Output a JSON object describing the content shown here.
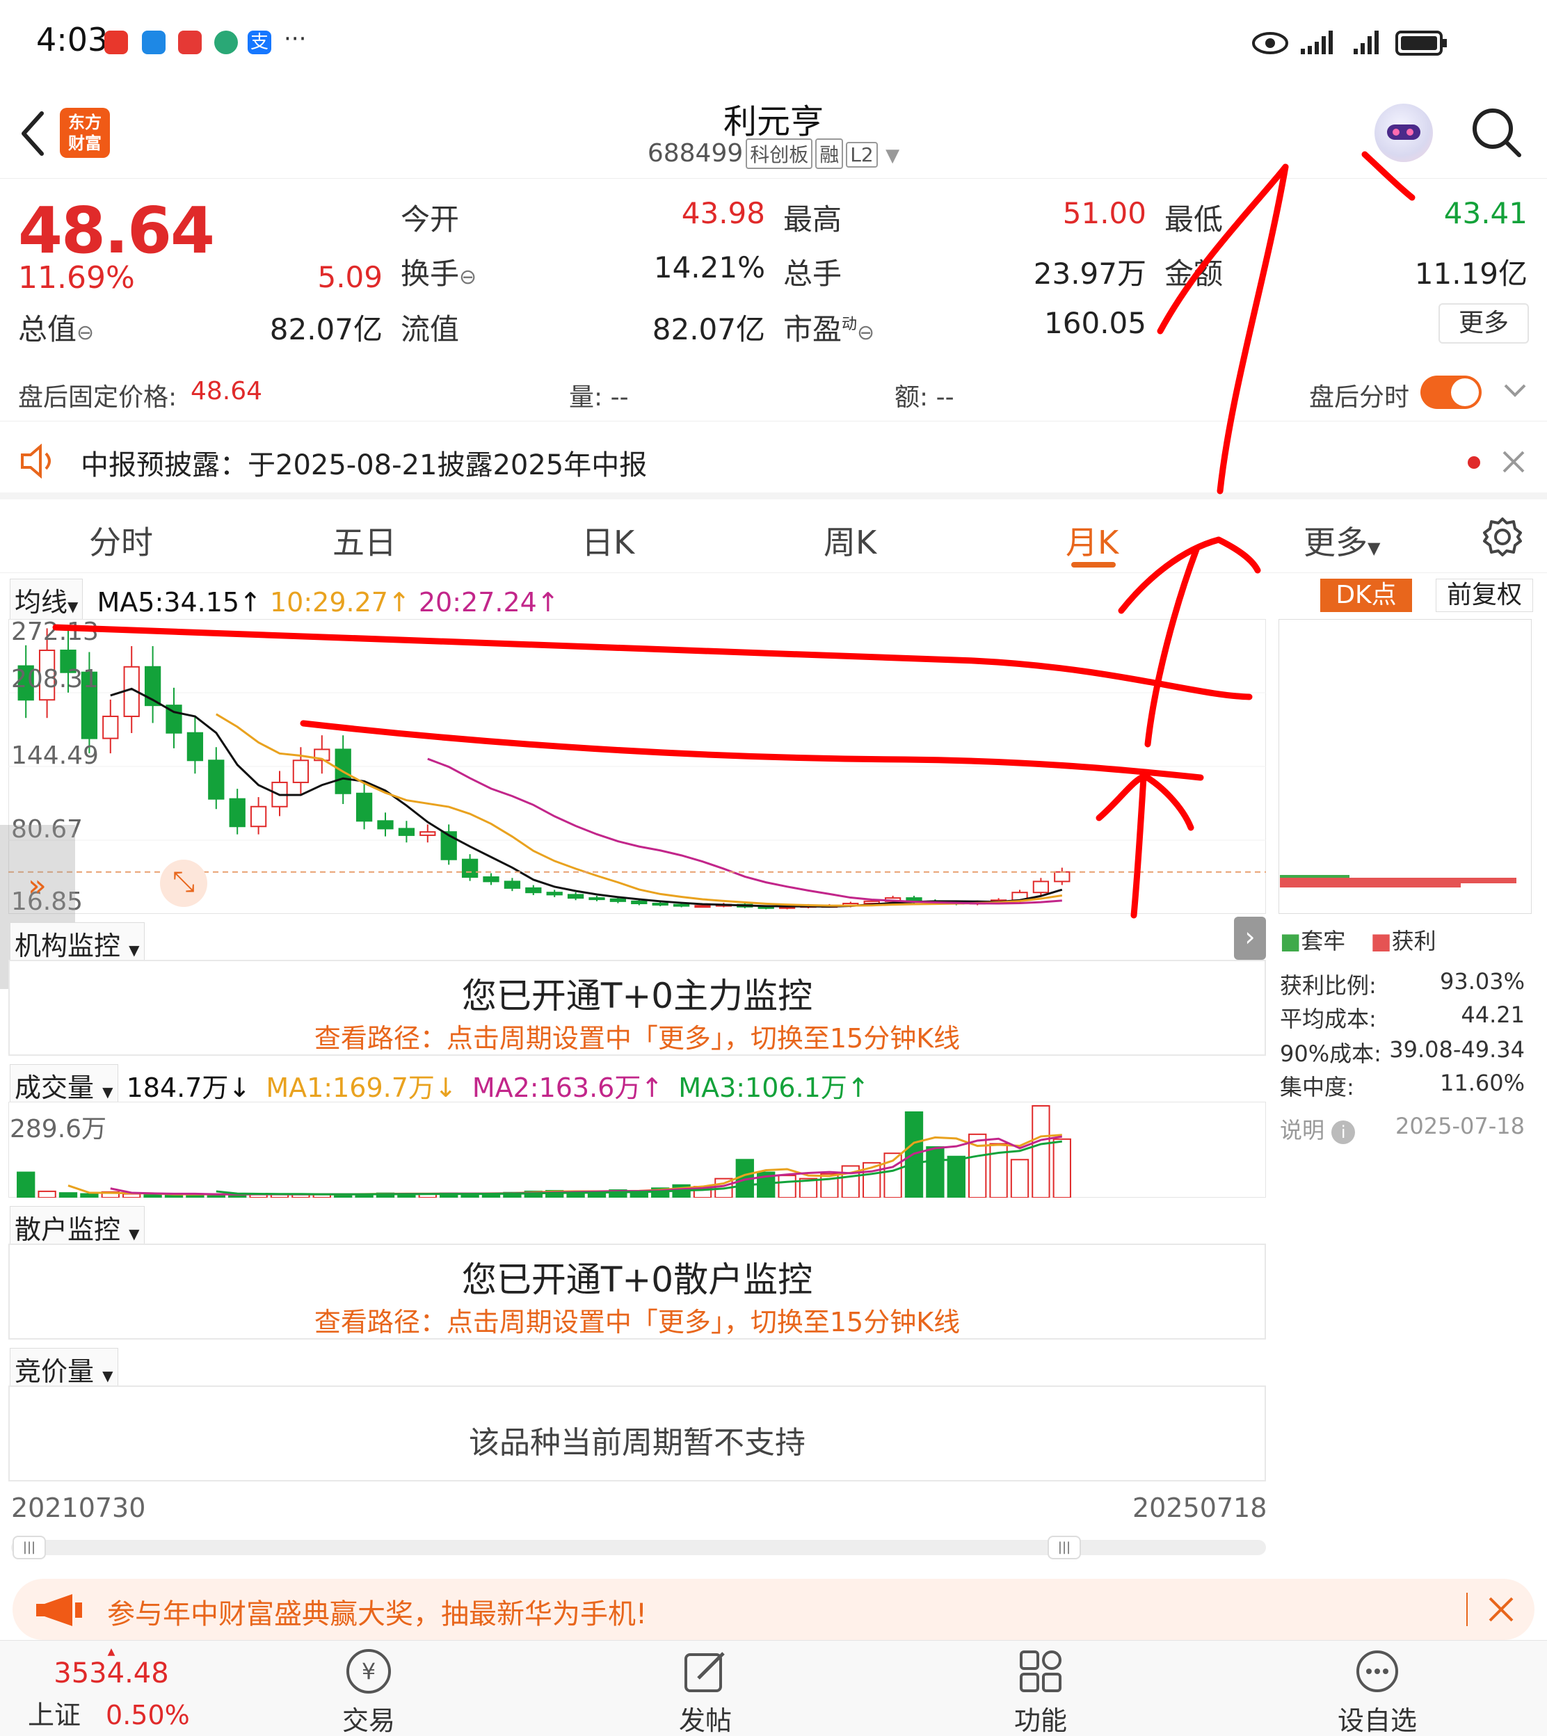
{
  "status_bar": {
    "time": "4:03",
    "more": "···"
  },
  "header": {
    "back_icon": "chevron-left-icon",
    "logo_text": [
      "东方",
      "财富"
    ],
    "stock_name": "利元亨",
    "stock_code": "688499",
    "tags": [
      "科创板",
      "融",
      "L2"
    ],
    "search_icon": "search-icon"
  },
  "quote": {
    "price": "48.64",
    "change_pct": "11.69%",
    "change_amt": "5.09",
    "total_value_label": "总值",
    "total_value": "82.07亿",
    "open_label": "今开",
    "open": "43.98",
    "turnover_label": "换手",
    "turnover": "14.21%",
    "float_value_label": "流值",
    "float_value": "82.07亿",
    "high_label": "最高",
    "high": "51.00",
    "volume_label": "总手",
    "volume": "23.97万",
    "pe_label": "市盈",
    "pe_sup": "动",
    "pe": "160.05",
    "low_label": "最低",
    "low": "43.41",
    "amount_label": "金额",
    "amount": "11.19亿",
    "more_button": "更多"
  },
  "after_hours": {
    "fixed_price_label": "盘后固定价格:",
    "fixed_price": "48.64",
    "vol_label": "量: --",
    "amt_label": "额: --",
    "toggle_label": "盘后分时"
  },
  "notice": {
    "text": "中报预披露：于2025-08-21披露2025年中报"
  },
  "tabs": [
    "分时",
    "五日",
    "日K",
    "周K",
    "月K",
    "更多"
  ],
  "active_tab": "月K",
  "kline": {
    "indicator_dropdown": "均线",
    "ma5": "MA5:34.15↑",
    "ma10": "10:29.27↑",
    "ma20": "20:27.24↑",
    "dk_button": "DK点",
    "adjust_button": "前复权",
    "y_labels": [
      "272.13",
      "208.31",
      "144.49",
      "80.67",
      "16.85"
    ],
    "colors": {
      "up": "#e02a2a",
      "down": "#13a23a",
      "ma5": "#111111",
      "ma10": "#e9a21f",
      "ma20": "#c2268a"
    }
  },
  "chart_data": [
    {
      "type": "candlestick",
      "title": "",
      "ylim": [
        16.85,
        272.13
      ],
      "values_close": [
        205,
        250,
        230,
        170,
        190,
        235,
        200,
        175,
        150,
        115,
        90,
        108,
        130,
        150,
        160,
        120,
        95,
        88,
        82,
        85,
        60,
        44,
        40,
        34,
        30,
        28,
        25,
        24,
        22,
        20,
        19,
        18,
        18,
        19,
        17,
        16,
        17,
        18,
        18,
        20,
        22,
        25,
        22,
        21,
        20,
        21,
        23,
        30,
        40,
        48.64
      ],
      "ma_labels": [
        "MA5",
        "MA10",
        "MA20"
      ]
    },
    {
      "type": "bar",
      "title": "",
      "ylim": [
        0,
        289.6
      ],
      "values": [
        80,
        20,
        15,
        12,
        18,
        12,
        10,
        10,
        12,
        10,
        10,
        12,
        10,
        10,
        12,
        10,
        12,
        14,
        12,
        12,
        14,
        12,
        14,
        16,
        20,
        22,
        18,
        20,
        24,
        20,
        30,
        40,
        35,
        60,
        120,
        80,
        70,
        60,
        75,
        100,
        110,
        140,
        270,
        160,
        130,
        200,
        170,
        120,
        289.6,
        184.7
      ]
    }
  ],
  "institution_monitor": {
    "dropdown": "机构监控",
    "title": "您已开通T+0主力监控",
    "hint": "查看路径：点击周期设置中「更多」，切换至15分钟K线"
  },
  "volume": {
    "dropdown": "成交量",
    "value": "184.7万↓",
    "ma1": "MA1:169.7万↓",
    "ma2": "MA2:163.6万↑",
    "ma3": "MA3:106.1万↑",
    "y_max": "289.6万"
  },
  "retail_monitor": {
    "dropdown": "散户监控",
    "title": "您已开通T+0散户监控",
    "hint": "查看路径：点击周期设置中「更多」，切换至15分钟K线"
  },
  "auction": {
    "dropdown": "竞价量",
    "unsupported": "该品种当前周期暂不支持"
  },
  "range": {
    "start": "20210730",
    "end": "20250718"
  },
  "chips": {
    "legend_trapped": "套牢",
    "legend_profit": "获利",
    "profit_ratio_label": "获利比例:",
    "profit_ratio": "93.03%",
    "avg_cost_label": "平均成本:",
    "avg_cost": "44.21",
    "cost90_label": "90%成本:",
    "cost90": "39.08-49.34",
    "concentration_label": "集中度:",
    "concentration": "11.60%",
    "note_label": "说明",
    "date": "2025-07-18"
  },
  "banner": {
    "text": "参与年中财富盛典赢大奖，抽最新华为手机!"
  },
  "bottom_nav": {
    "index_value": "3534.48",
    "index_name": "上证",
    "index_change": "0.50%",
    "items": [
      "交易",
      "发帖",
      "功能",
      "设自选"
    ]
  }
}
